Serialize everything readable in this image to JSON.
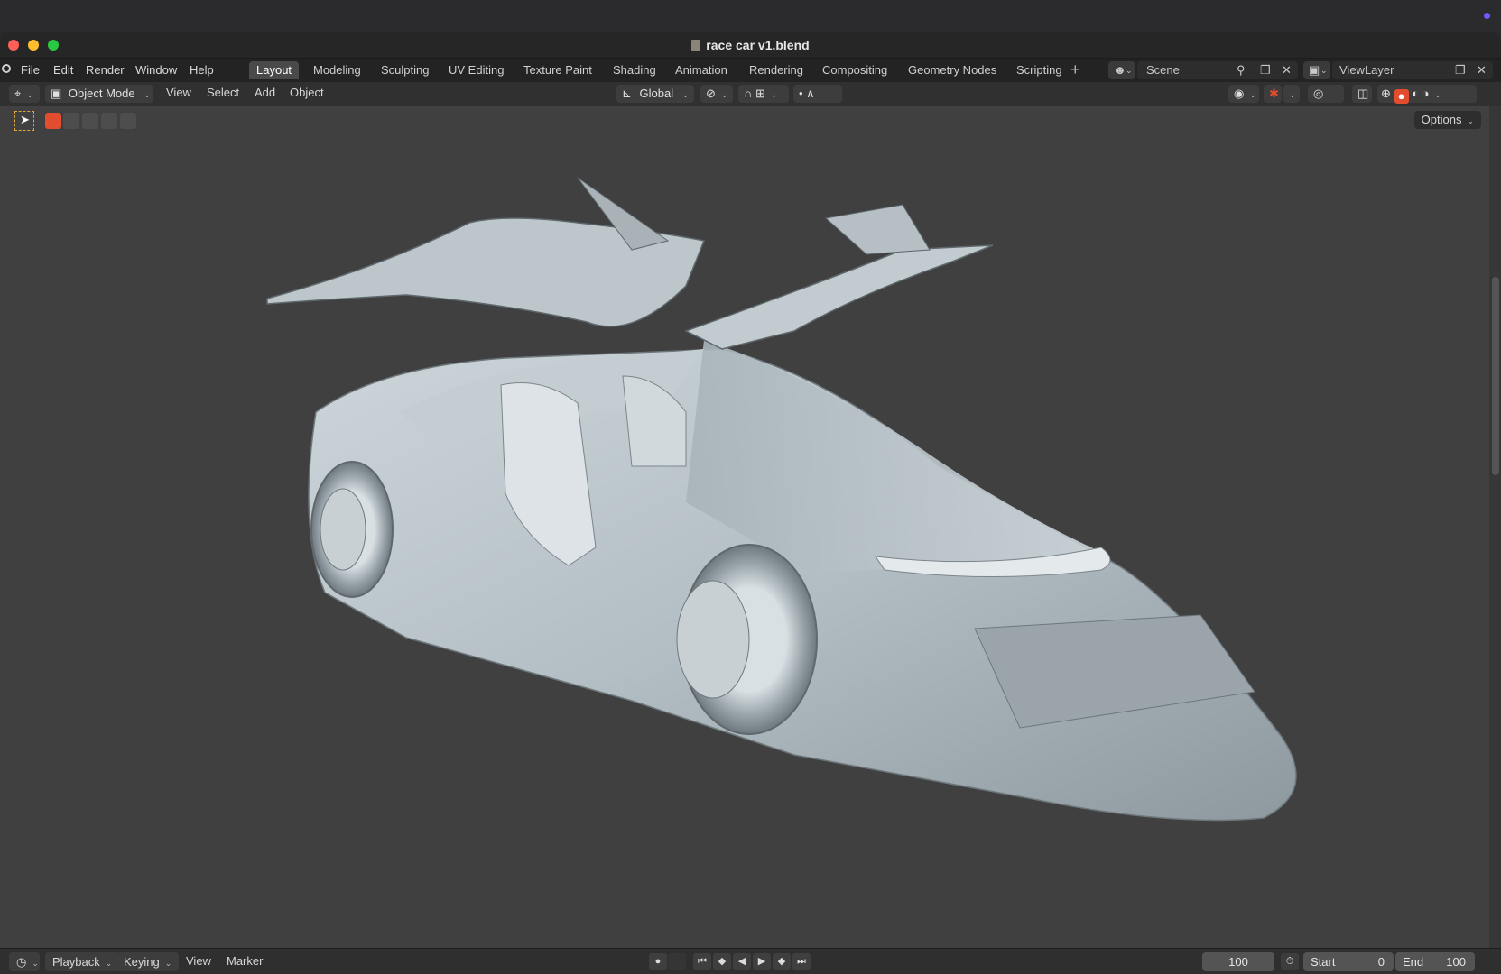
{
  "window": {
    "title": "race car v1.blend"
  },
  "menu": [
    "File",
    "Edit",
    "Render",
    "Window",
    "Help"
  ],
  "workspaces": {
    "active": "Layout",
    "tabs": [
      "Layout",
      "Modeling",
      "Sculpting",
      "UV Editing",
      "Texture Paint",
      "Shading",
      "Animation",
      "Rendering",
      "Compositing",
      "Geometry Nodes",
      "Scripting"
    ]
  },
  "scene": {
    "label": "Scene"
  },
  "view_layer": {
    "label": "ViewLayer"
  },
  "header": {
    "mode": "Object Mode",
    "menus": [
      "View",
      "Select",
      "Add",
      "Object"
    ],
    "transform_orientation": "Global",
    "options": "Options"
  },
  "timeline": {
    "playback": "Playback",
    "keying": "Keying",
    "view": "View",
    "marker": "Marker",
    "current_frame": "100",
    "start_label": "Start",
    "start_value": "0",
    "end_label": "End",
    "end_value": "100"
  },
  "colors": {
    "accent": "#e24c2f",
    "viewport_bg": "#404040",
    "model": "#b9c3c8"
  }
}
